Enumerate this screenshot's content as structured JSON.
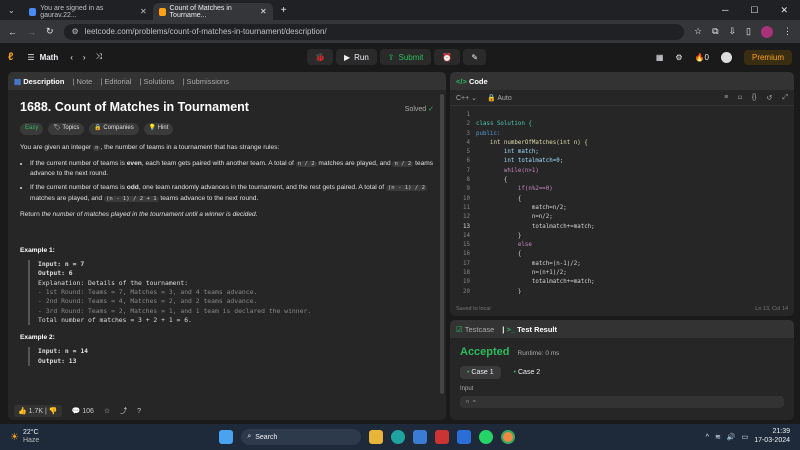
{
  "browser": {
    "tabs": [
      {
        "label": "You are signed in as gaurav.22..."
      },
      {
        "label": "Count of Matches in Tourname..."
      }
    ],
    "url": "leetcode.com/problems/count-of-matches-in-tournament/description/"
  },
  "topbar": {
    "menu": "Math",
    "run": "Run",
    "submit": "Submit",
    "streak": "0",
    "premium": "Premium"
  },
  "left": {
    "tabs": [
      "Description",
      "Note",
      "Editorial",
      "Solutions",
      "Submissions"
    ],
    "title": "1688. Count of Matches in Tournament",
    "status": "Solved",
    "tags": [
      "Easy",
      "Topics",
      "Companies",
      "Hint"
    ],
    "p1a": "You are given an integer ",
    "p1code": "n",
    "p1b": ", the number of teams in a tournament that has strange rules:",
    "b1a": "If the current number of teams is ",
    "b1even": "even",
    "b1b": ", each team gets paired with another team. A total of ",
    "b1c1": "n / 2",
    "b1c": " matches are played, and ",
    "b1c2": "n / 2",
    "b1d": " teams advance to the next round.",
    "b2a": "If the current number of teams is ",
    "b2odd": "odd",
    "b2b": ", one team randomly advances in the tournament, and the rest gets paired. A total of ",
    "b2c1": "(n - 1) / 2",
    "b2c": " matches are played, and ",
    "b2c2": "(n - 1) / 2 + 1",
    "b2d": " teams advance to the next round.",
    "ret1": "Return ",
    "ret2": "the number of matches played in the tournament until a winner is decided.",
    "ex1": "Example 1:",
    "ex1_lines": [
      "Input: n = 7",
      "Output: 6",
      "Explanation: Details of the tournament:",
      "- 1st Round: Teams = 7, Matches = 3, and 4 teams advance.",
      "- 2nd Round: Teams = 4, Matches = 2, and 2 teams advance.",
      "- 3rd Round: Teams = 2, Matches = 1, and 1 team is declared the winner.",
      "Total number of matches = 3 + 2 + 1 = 6."
    ],
    "ex2": "Example 2:",
    "ex2_lines": [
      "Input: n = 14",
      "Output: 13"
    ],
    "likes": "1.7K",
    "comments": "106"
  },
  "editor": {
    "title": "Code",
    "lang": "C++",
    "mode": "Auto",
    "saved": "Saved to local",
    "pos": "Ln 13, Col 14",
    "lines": [
      "class Solution {",
      "public:",
      "    int numberOfMatches(int n) {",
      "        int match;",
      "        int totalmatch=0;",
      "        while(n>1)",
      "        {",
      "            if(n%2==0)",
      "            {",
      "                match=n/2;",
      "                n=n/2;",
      "                totalmatch+=match;",
      "            }",
      "            else",
      "            {",
      "                match=(n-1)/2;",
      "                n=(n+1)/2;",
      "                totalmatch+=match;",
      "",
      "            }"
    ]
  },
  "result": {
    "tab1": "Testcase",
    "tab2": "Test Result",
    "verdict": "Accepted",
    "runtime": "Runtime: 0 ms",
    "case1": "Case 1",
    "case2": "Case 2",
    "input": "Input",
    "inval": "n ="
  },
  "taskbar": {
    "temp": "22°C",
    "weather": "Haze",
    "search": "Search",
    "time": "21:39",
    "date": "17-03-2024",
    "lang": "ENG\nIN"
  },
  "colors": {
    "accent": "#ffa116",
    "green": "#2cbb5d"
  }
}
